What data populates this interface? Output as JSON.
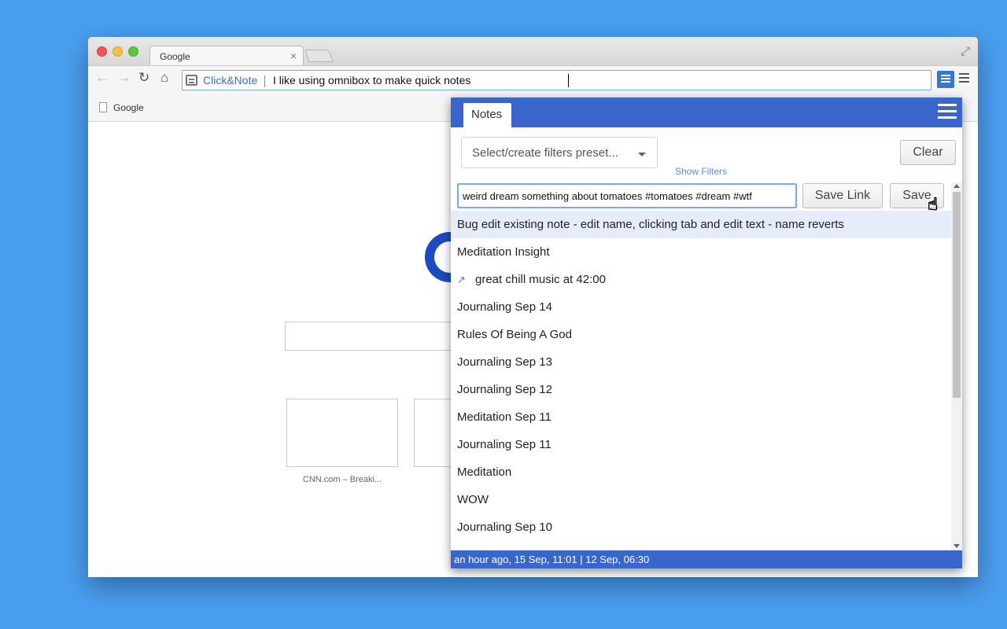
{
  "browser": {
    "tab_title": "Google",
    "tab_close": "×",
    "omnibox": {
      "keyword": "Click&Note",
      "text": "I like using omnibox to make quick notes"
    },
    "bookmark": "Google"
  },
  "page": {
    "tile_label": "CNN.com – Breaki..."
  },
  "popup": {
    "tab_label": "Notes",
    "preset_placeholder": "Select/create filters preset...",
    "show_filters": "Show Filters",
    "clear_label": "Clear",
    "note_input_value": "weird dream something about tomatoes #tomatoes #dream #wtf",
    "save_link_label": "Save Link",
    "save_label": "Save",
    "notes": [
      {
        "title": "Bug edit existing note - edit name, clicking tab and edit text - name reverts",
        "link": false,
        "active": true
      },
      {
        "title": "Meditation Insight",
        "link": false,
        "active": false
      },
      {
        "title": "great chill music at 42:00",
        "link": true,
        "active": false
      },
      {
        "title": "Journaling Sep 14",
        "link": false,
        "active": false
      },
      {
        "title": "Rules Of Being A God",
        "link": false,
        "active": false
      },
      {
        "title": "Journaling Sep 13",
        "link": false,
        "active": false
      },
      {
        "title": "Journaling Sep 12",
        "link": false,
        "active": false
      },
      {
        "title": "Meditation Sep 11",
        "link": false,
        "active": false
      },
      {
        "title": "Journaling Sep 11",
        "link": false,
        "active": false
      },
      {
        "title": "Meditation",
        "link": false,
        "active": false
      },
      {
        "title": "WOW",
        "link": false,
        "active": false
      },
      {
        "title": "Journaling Sep 10",
        "link": false,
        "active": false
      }
    ],
    "footer": "an hour ago, 15 Sep, 11:01 | 12 Sep, 06:30"
  },
  "colors": {
    "desktop": "#4a9ef0",
    "popup_accent": "#3a66cc",
    "link_text": "#5a8fe0"
  }
}
